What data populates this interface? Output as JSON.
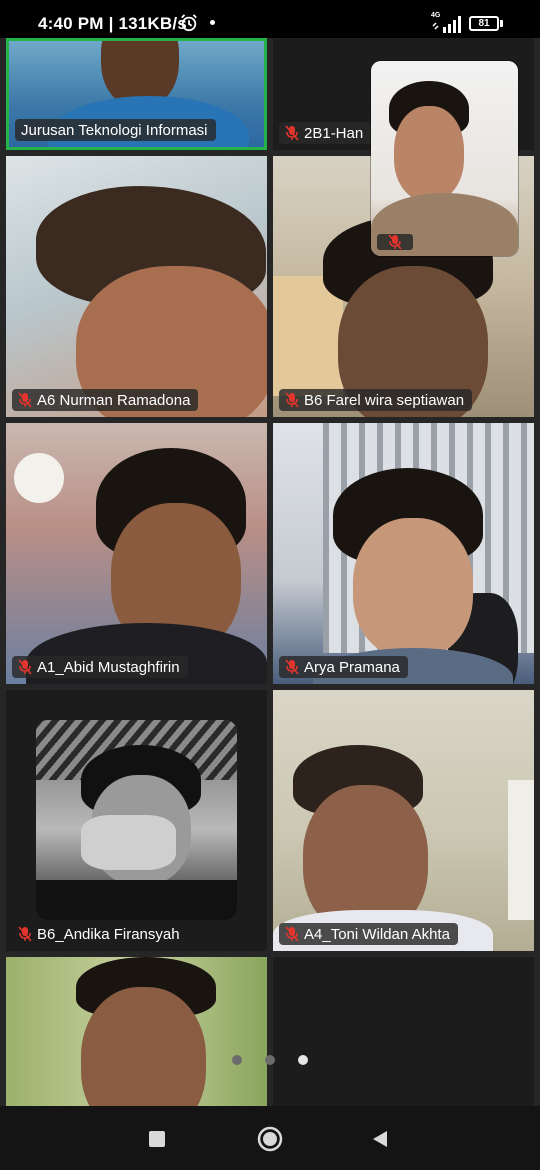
{
  "status_bar": {
    "time": "4:40 PM",
    "speed": "131KB/s",
    "network": "4G",
    "battery": "81",
    "icons": [
      "alarm-icon",
      "dot-icon",
      "signal-icon",
      "battery-icon"
    ]
  },
  "participants": [
    {
      "name": "Jurusan Teknologi Informasi",
      "muted": false,
      "active_speaker": true
    },
    {
      "name": "2B1-Han",
      "muted": true
    },
    {
      "name": "A6 Nurman Ramadona",
      "muted": true
    },
    {
      "name": "B6 Farel wira septiawan",
      "muted": true
    },
    {
      "name": "A1_Abid Mustaghfirin",
      "muted": true
    },
    {
      "name": "Arya Pramana",
      "muted": true
    },
    {
      "name": "B6_Andika Firansyah",
      "muted": true
    },
    {
      "name": "A4_Toni Wildan Akhta",
      "muted": true
    },
    {
      "name": "",
      "muted": false
    }
  ],
  "self_view": {
    "muted": true
  },
  "pagination": {
    "pages": 3,
    "current": 3
  },
  "nav": {
    "icons": [
      "recent-apps-icon",
      "home-icon",
      "back-icon"
    ]
  },
  "colors": {
    "active_border": "#25b24a",
    "mute_red": "#e3352d"
  }
}
